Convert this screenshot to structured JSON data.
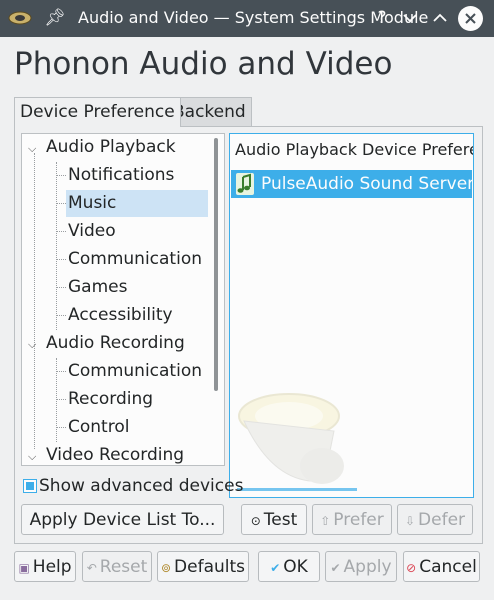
{
  "window": {
    "title": "Audio and Video — System Settings Module",
    "controls": {
      "help": "?",
      "minimize": "⌄",
      "maximize": "⌃",
      "close": "✕"
    }
  },
  "page_title": "Phonon Audio and Video",
  "tabs": [
    {
      "label": "Device Preference",
      "active": true
    },
    {
      "label": "Backend",
      "active": false
    }
  ],
  "tree": {
    "items": [
      {
        "label": "Audio Playback",
        "level": 0,
        "expanded": true
      },
      {
        "label": "Notifications",
        "level": 1
      },
      {
        "label": "Music",
        "level": 1,
        "selected": true
      },
      {
        "label": "Video",
        "level": 1
      },
      {
        "label": "Communication",
        "level": 1
      },
      {
        "label": "Games",
        "level": 1
      },
      {
        "label": "Accessibility",
        "level": 1
      },
      {
        "label": "Audio Recording",
        "level": 0,
        "expanded": true
      },
      {
        "label": "Communication",
        "level": 1
      },
      {
        "label": "Recording",
        "level": 1
      },
      {
        "label": "Control",
        "level": 1
      },
      {
        "label": "Video Recording",
        "level": 0,
        "expanded": true
      }
    ]
  },
  "device_list": {
    "header": "Audio Playback Device Preference for 'Music' Category",
    "devices": [
      {
        "label": "PulseAudio Sound Server",
        "selected": true,
        "icon": "music-note-icon"
      }
    ]
  },
  "show_advanced": {
    "label": "Show advanced devices",
    "checked": true
  },
  "buttons": {
    "apply_device_list": "Apply Device List To...",
    "test": "Test",
    "prefer": "Prefer",
    "defer": "Defer",
    "help": "Help",
    "reset": "Reset",
    "defaults": "Defaults",
    "ok": "OK",
    "apply": "Apply",
    "cancel": "Cancel"
  },
  "colors": {
    "accent": "#3daee9",
    "titlebar": "#475057",
    "selection_light": "#cde3f5",
    "cancel_red": "#da4453"
  }
}
